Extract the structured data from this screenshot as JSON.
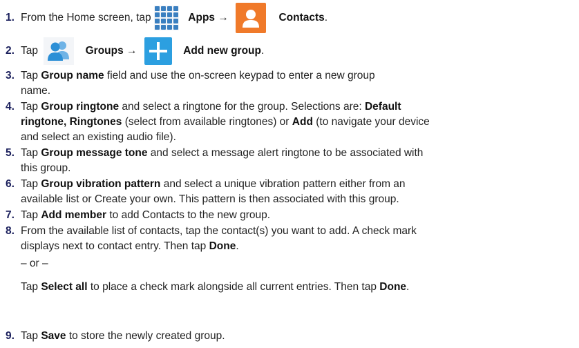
{
  "steps": [
    {
      "num": "1.",
      "pre": "From the Home screen, tap ",
      "b1": "Apps",
      "arrow": " → ",
      "b2": "Contacts",
      "end": "."
    },
    {
      "num": "2.",
      "pre": "Tap ",
      "b1": "Groups",
      "arrow": " → ",
      "b2": "Add new group",
      "end": "."
    },
    {
      "num": "3.",
      "a": "Tap ",
      "b": "Group name",
      "c": " field and use the on-screen keypad to enter a new group",
      "line2": "name."
    },
    {
      "num": "4.",
      "a": "Tap ",
      "b": "Group ringtone",
      "c": " and select a ringtone for the group. Selections are: ",
      "d": "Default",
      "line2_b": "ringtone, Ringtones",
      "line2_c": " (select from available ringtones) or ",
      "line2_d": "Add",
      "line2_e": " (to navigate your device",
      "line3": "and select an existing audio file)."
    },
    {
      "num": "5.",
      "a": "Tap ",
      "b": "Group message tone",
      "c": " and select a message alert ringtone to be associated with",
      "line2": "this group."
    },
    {
      "num": "6.",
      "a": "Tap ",
      "b": "Group vibration pattern",
      "c": " and select a unique vibration pattern either from an",
      "line2": "available list or Create your own. This pattern is then associated with this group."
    },
    {
      "num": "7.",
      "a": "Tap ",
      "b": "Add member",
      "c": " to add Contacts to the new group."
    },
    {
      "num": "8.",
      "line1": "From the available list of contacts, tap the contact(s) you want to add. A check mark",
      "line2_a": "displays next to contact entry. Then tap ",
      "line2_b": "Done",
      "line2_c": ".",
      "or": "– or –",
      "alt_a": "Tap ",
      "alt_b": "Select all",
      "alt_c": " to place a check mark alongside all current entries. Then tap ",
      "alt_d": "Done",
      "alt_e": "."
    },
    {
      "num": "9.",
      "a": "Tap ",
      "b": "Save",
      "c": " to store the newly created group."
    }
  ],
  "icons": {
    "apps": "apps-grid-icon",
    "contacts": "contacts-person-icon",
    "groups": "groups-people-icon",
    "add": "plus-icon"
  },
  "colors": {
    "step_number": "#1a1f5c",
    "apps_icon": "#3a7fc0",
    "contacts_icon": "#f07a2a",
    "add_icon": "#2c9fe0",
    "groups_icon": "#2c8fd6"
  }
}
